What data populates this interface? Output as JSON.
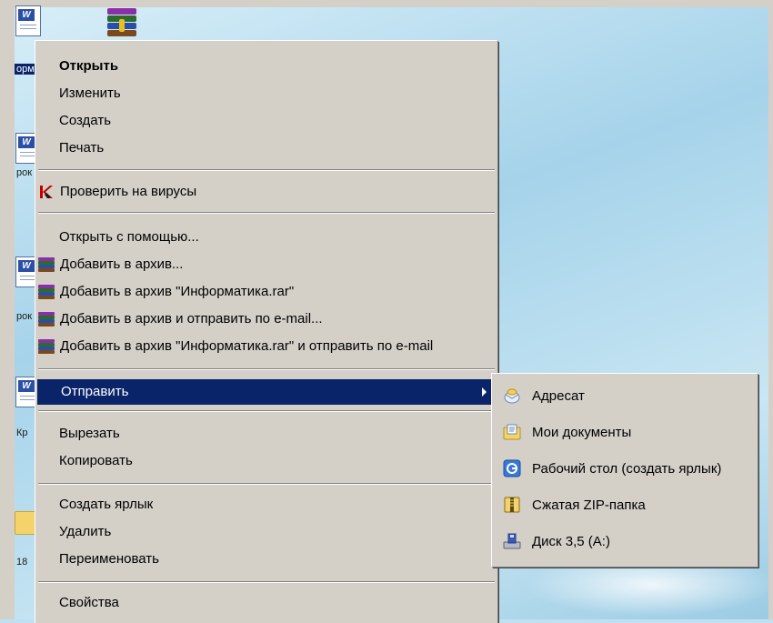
{
  "desktop": {
    "labels": [
      "орм",
      "рок",
      "рок",
      "Кр",
      "18"
    ]
  },
  "context_menu": {
    "items": [
      {
        "label": "Открыть",
        "bold": true
      },
      {
        "label": "Изменить"
      },
      {
        "label": "Создать"
      },
      {
        "label": "Печать"
      },
      {
        "label": "Проверить на вирусы",
        "icon": "kaspersky-icon"
      },
      {
        "label": "Открыть с помощью..."
      },
      {
        "label": "Добавить в архив...",
        "icon": "winrar-icon"
      },
      {
        "label": "Добавить в архив \"Информатика.rar\"",
        "icon": "winrar-icon"
      },
      {
        "label": "Добавить в архив и отправить по e-mail...",
        "icon": "winrar-icon"
      },
      {
        "label": "Добавить в архив \"Информатика.rar\" и отправить по e-mail",
        "icon": "winrar-icon"
      },
      {
        "label": "Отправить",
        "highlighted": true,
        "has_submenu": true
      },
      {
        "label": "Вырезать"
      },
      {
        "label": "Копировать"
      },
      {
        "label": "Создать ярлык"
      },
      {
        "label": "Удалить"
      },
      {
        "label": "Переименовать"
      },
      {
        "label": "Свойства"
      }
    ]
  },
  "send_to_submenu": {
    "items": [
      {
        "label": "Адресат",
        "icon": "mail-recipient-icon"
      },
      {
        "label": "Мои документы",
        "icon": "my-documents-icon"
      },
      {
        "label": "Рабочий стол (создать ярлык)",
        "icon": "desktop-shortcut-icon"
      },
      {
        "label": "Сжатая ZIP-папка",
        "icon": "zip-folder-icon"
      },
      {
        "label": "Диск 3,5 (A:)",
        "icon": "floppy-drive-icon"
      }
    ]
  },
  "colors": {
    "menu_bg": "#d4d0c8",
    "highlight": "#0a246a",
    "highlight_text": "#ffffff"
  }
}
